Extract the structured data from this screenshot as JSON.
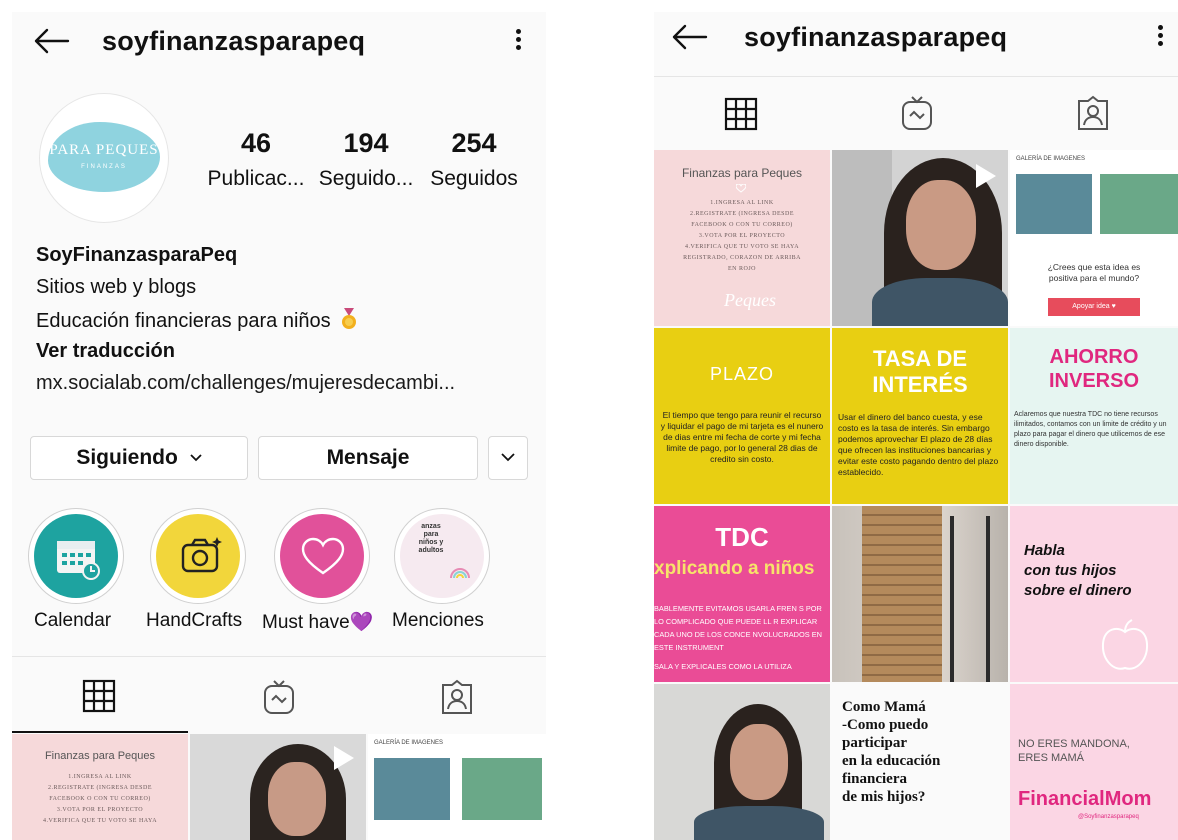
{
  "username": "soyfinanzasparapeq",
  "profile": {
    "avatar_title": "PARA PEQUES",
    "avatar_subtitle": "FINANZAS",
    "posts_count": "46",
    "posts_label": "Publicac...",
    "followers_count": "194",
    "followers_label": "Seguido...",
    "following_count": "254",
    "following_label": "Seguidos",
    "name": "SoyFinanzasparaPeq",
    "category": "Sitios web y blogs",
    "bio": "Educación financieras para niños",
    "translate": "Ver traducción",
    "link": "mx.socialab.com/challenges/mujeresdecambi..."
  },
  "actions": {
    "following": "Siguiendo",
    "message": "Mensaje"
  },
  "highlights": [
    {
      "label": "Calendar"
    },
    {
      "label": "HandCrafts"
    },
    {
      "label": "Must have",
      "emoji": "💜"
    },
    {
      "label": "Menciones",
      "cover_text": "anzas\npara\nniños y\nadultos"
    }
  ],
  "posts": {
    "p1": {
      "title": "Finanzas para Peques",
      "lines": [
        "1.INGRESA AL LINK",
        "2.REGISTRATE (INGRESA DESDE",
        "FACEBOOK O CON TU CORREO)",
        "3.VOTA POR EL PROYECTO",
        "4.VERIFICA QUE TU VOTO SE HAYA",
        "REGISTRADO, CORAZON DE ARRIBA",
        "EN ROJO"
      ],
      "script": "Peques"
    },
    "p3": {
      "header": "GALERÍA DE IMAGENES",
      "question": "¿Crees que esta idea es positiva para el mundo?",
      "button": "Apoyar idea"
    },
    "p4": {
      "title": "PLAZO",
      "body": "El tiempo que tengo para reunir el recurso y liquidar el pago de mi tarjeta es el nunero de dias entre mi fecha de corte y mi fecha limite de pago, por lo general 28 dias de credito sin costo."
    },
    "p5": {
      "title1": "TASA DE",
      "title2": "INTERÉS",
      "body": "Usar el dinero del banco cuesta, y ese costo es la tasa de interés. Sin embargo podemos aprovechar El plazo de 28 días que ofrecen las instituciones bancarias y evitar este costo pagando dentro del plazo establecido."
    },
    "p6": {
      "title1": "AHORRO",
      "title2": "INVERSO",
      "body": "Aclaremos que nuestra TDC no tiene recursos ilimitados, contamos con un limite de crédito y un plazo para pagar el dinero que utilicemos de ese dinero disponible."
    },
    "p7": {
      "title": "TDC",
      "subtitle": "xplicando a niños",
      "body": "BABLEMENTE EVITAMOS USARLA FREN S POR LO COMPLICADO QUE PUEDE LL R EXPLICAR CADA UNO DE LOS CONCE NVOLUCRADOS EN ESTE INSTRUMENT",
      "footer": "SALA Y EXPLICALES COMO LA UTILIZA"
    },
    "p9": {
      "line1": "Habla",
      "line2": "con tus hijos",
      "line3": "sobre el dinero"
    },
    "p11": {
      "line1": "Como Mamá",
      "line2": "-Como puedo",
      "line3": "participar",
      "line4": "en la educación",
      "line5": "financiera",
      "line6": "de mis hijos?"
    },
    "p12": {
      "line1": "NO ERES MANDONA,",
      "line2": "ERES MAMÁ",
      "brand": "FinancialMom",
      "handle": "@Soyfinanzasparapeq"
    }
  },
  "colors": {
    "yellow": "#e8cf12",
    "pink": "#ea4c96",
    "mint": "#e6f5f1",
    "teal": "#1ea3a0",
    "blush": "#f6d9da",
    "light_pink": "#fbd6e4"
  }
}
